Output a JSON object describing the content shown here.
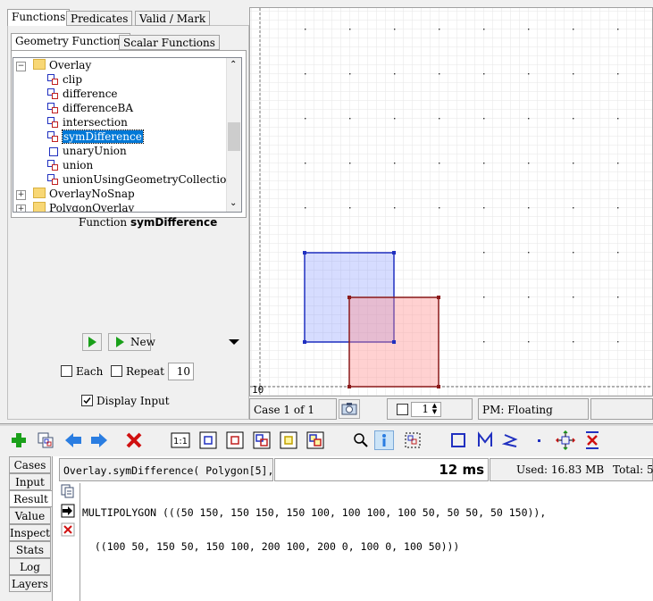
{
  "top_tabs": [
    "Functions",
    "Predicates",
    "Valid / Mark"
  ],
  "sub_tabs": [
    "Geometry Functions",
    "Scalar Functions"
  ],
  "tree": {
    "group_open": "Overlay",
    "items": [
      "clip",
      "difference",
      "differenceBA",
      "intersection",
      "symDifference",
      "unaryUnion",
      "union",
      "unionUsingGeometryCollection"
    ],
    "group_closed_1": "OverlayNoSnap",
    "group_closed_2": "PolygonOverlay"
  },
  "function_label": {
    "prefix": "Function",
    "name": "symDifference"
  },
  "controls": {
    "run_new_label": "New",
    "each_label": "Each",
    "repeat_label": "Repeat",
    "repeat_value": "10",
    "display_input_label": "Display Input",
    "display_input_checked": true
  },
  "canvas": {
    "axis_label": "10"
  },
  "status": {
    "case_text": "Case 1 of 1",
    "spinner_value": "1",
    "pm_text": "PM: Floating"
  },
  "result_bar": {
    "expression": "Overlay.symDifference( Polygon[5],...",
    "time": "12 ms",
    "used": "Used: 16.83 MB",
    "total": "Total: 5"
  },
  "side_tabs": [
    "Cases",
    "Input",
    "Result",
    "Value",
    "Inspect",
    "Stats",
    "Log",
    "Layers"
  ],
  "result_text": {
    "line1": "MULTIPOLYGON (((50 150, 150 150, 150 100, 100 100, 100 50, 50 50, 50 150)),",
    "line2": "  ((100 50, 150 50, 150 100, 200 100, 200 0, 100 0, 100 50)))"
  },
  "colors": {
    "selection": "#0078d7",
    "geom_a": "#2030c0",
    "geom_b": "#8b1a1a",
    "add": "#1aa01a",
    "arrow": "#2a7de1",
    "delete": "#d01010"
  }
}
